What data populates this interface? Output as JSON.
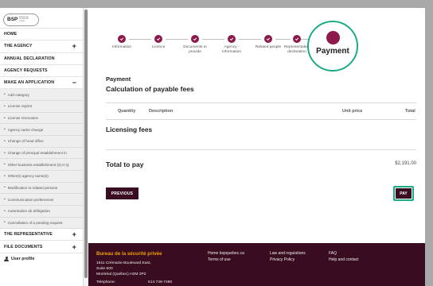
{
  "logo": {
    "mark": "BSP",
    "tag": "Bureau de la sécurité privée"
  },
  "sidebar": {
    "top_items": [
      {
        "label": "HOME",
        "sign": ""
      },
      {
        "label": "THE AGENCY",
        "sign": "+"
      },
      {
        "label": "ANNUAL DECLARATION",
        "sign": ""
      },
      {
        "label": "AGENCY REQUESTS",
        "sign": ""
      },
      {
        "label": "MAKE AN APPLICATION",
        "sign": "−"
      }
    ],
    "sub_items": [
      "Add category",
      "License reprint",
      "License revocation",
      "Agency name change",
      "Change of head office",
      "Change of principal establishment in",
      "Other business establishment (s) in Q",
      "Other(s) agency name(s)",
      "Modification to related persons",
      "Communication preferences",
      "Autorisation de délégation",
      "Cancellation of a pending request"
    ],
    "bottom_items": [
      {
        "label": "THE REPRESENTATIVE",
        "sign": "+"
      },
      {
        "label": "FILE DOCUMENTS",
        "sign": "+"
      }
    ],
    "user": "User profile"
  },
  "steps": [
    "Information",
    "Licence",
    "Documents to provide",
    "Agency - Information",
    "Related people",
    "Representative declaration"
  ],
  "current_step": "Payment",
  "main": {
    "title": "Payment",
    "subtitle": "Calculation of payable fees",
    "columns": {
      "quantity": "Quantity",
      "description": "Description",
      "unit_price": "Unit price",
      "total": "Total"
    },
    "fees_label": "Licensing fees",
    "total_label": "Total to pay",
    "total_value": "$2,191.00",
    "previous_label": "PREVIOUS",
    "pay_label": "PAY"
  },
  "footer": {
    "brand": "Bureau de la sécurité privée",
    "address_1": "1611 Crémazie Boulevard East,",
    "address_2": "Suite 500",
    "address_3": "Montréal (Québec) H2M 2P2",
    "phone_label": "Telephone:",
    "phone": "514 748-7480",
    "links": {
      "home": "Home bspquebec.ca",
      "terms": "Terms of use",
      "law": "Law and regulations",
      "privacy": "Privacy Policy",
      "faq": "FAQ",
      "help": "Help and contact"
    }
  },
  "colors": {
    "primary": "#8c1a4b",
    "dark": "#3b0d22",
    "focus": "#1cab85",
    "brand_accent": "#f0a000"
  }
}
